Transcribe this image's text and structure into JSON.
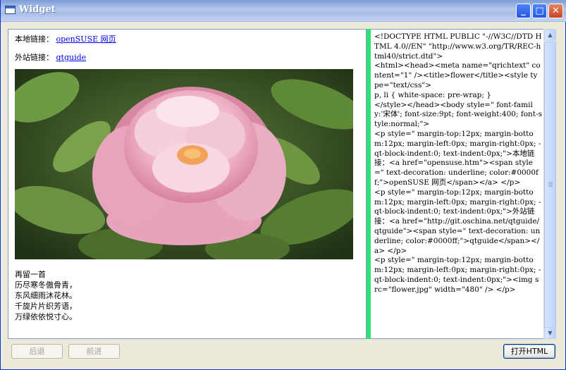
{
  "window": {
    "title": "Widget"
  },
  "titlebar": {
    "minimize": "_",
    "maximize": "□",
    "close": "✕"
  },
  "viewer": {
    "local_link": {
      "label": "本地链接：",
      "text": "openSUSE 网页"
    },
    "external_link": {
      "label": "外站链接：",
      "text": "qtguide"
    },
    "image_icon": "peony-flower-image",
    "poem": [
      "再留一首",
      "历尽寒冬傲骨青，",
      "东风细雨沐花林。",
      "千旋片片织芳语，",
      "万绿依依悦寸心。"
    ]
  },
  "source": {
    "text": "<!DOCTYPE HTML PUBLIC \"-//W3C//DTD HTML 4.0//EN\" \"http://www.w3.org/TR/REC-html40/strict.dtd\">\n<html><head><meta name=\"qrichtext\" content=\"1\" /><title>flower</title><style type=\"text/css\">\np, li { white-space: pre-wrap; }\n</style></head><body style=\" font-family:'宋体'; font-size:9pt; font-weight:400; font-style:normal;\">\n<p style=\" margin-top:12px; margin-bottom:12px; margin-left:0px; margin-right:0px; -qt-block-indent:0; text-indent:0px;\">本地链接：<a href=\"opensuse.htm\"><span style=\" text-decoration: underline; color:#0000ff;\">openSUSE 网页</span></a> </p>\n<p style=\" margin-top:12px; margin-bottom:12px; margin-left:0px; margin-right:0px; -qt-block-indent:0; text-indent:0px;\">外站链接：<a href=\"http://git.oschina.net/qtguide/qtguide\"><span style=\" text-decoration: underline; color:#0000ff;\">qtguide</span></a> </p>\n<p style=\" margin-top:12px; margin-bottom:12px; margin-left:0px; margin-right:0px; -qt-block-indent:0; text-indent:0px;\"><img src=\"flower.jpg\" width=\"480\" /> </p>"
  },
  "buttons": {
    "back": "后退",
    "forward": "前进",
    "open_html": "打开HTML"
  },
  "colors": {
    "link": "#0000ff",
    "splitter": "#2fe07a",
    "title_bar": "#a8bde6"
  }
}
